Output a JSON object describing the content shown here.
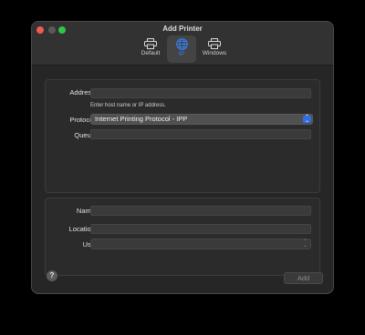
{
  "window": {
    "title": "Add Printer"
  },
  "toolbar": {
    "tabs": [
      {
        "label": "Default",
        "icon": "printer-icon"
      },
      {
        "label": "IP",
        "icon": "globe-icon",
        "selected": true
      },
      {
        "label": "Windows",
        "icon": "printer-icon"
      }
    ]
  },
  "form": {
    "address_label": "Address:",
    "address_value": "",
    "address_hint": "Enter host name or IP address.",
    "protocol_label": "Protocol:",
    "protocol_value": "Internet Printing Protocol - IPP",
    "queue_label": "Queue:",
    "queue_value": "",
    "name_label": "Name:",
    "name_value": "",
    "location_label": "Location:",
    "location_value": "",
    "use_label": "Use:",
    "use_value": ""
  },
  "footer": {
    "help_label": "?",
    "add_label": "Add"
  },
  "colors": {
    "accent": "#2f86ff",
    "close": "#ee5b54",
    "maximize": "#35c249"
  }
}
